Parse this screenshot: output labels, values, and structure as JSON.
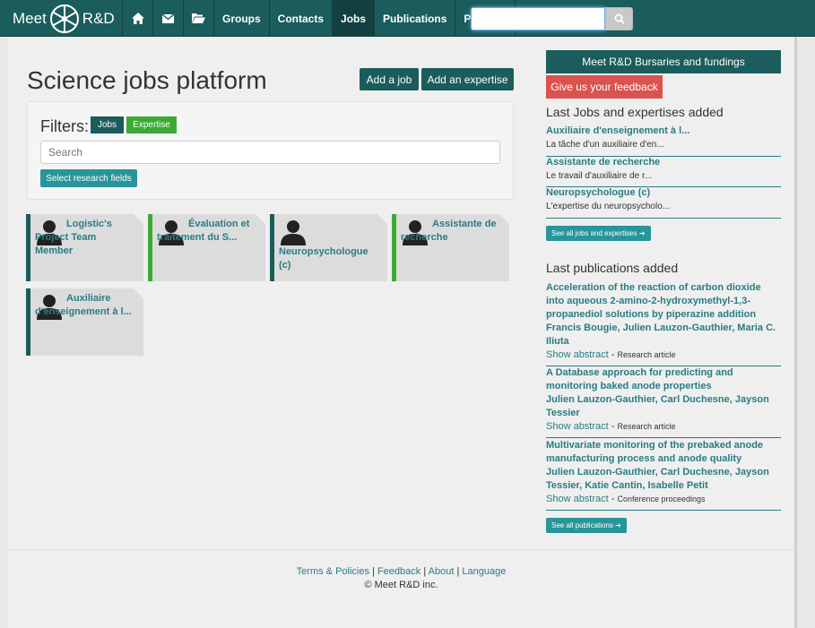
{
  "brand": {
    "left": "Meet",
    "right": "R&D"
  },
  "nav": {
    "home_icon": "home-icon",
    "mail_icon": "envelope-icon",
    "folder_icon": "folder-open-icon",
    "items": [
      {
        "label": "Groups"
      },
      {
        "label": "Contacts"
      },
      {
        "label": "Jobs",
        "active": true
      },
      {
        "label": "Publications"
      },
      {
        "label": "Projects"
      }
    ],
    "search_value": ""
  },
  "main": {
    "title": "Science jobs platform",
    "add_job": "Add a job",
    "add_expertise": "Add an expertise",
    "filters": {
      "label": "Filters:",
      "tag_jobs": "Jobs",
      "tag_expertise": "Expertise",
      "search_placeholder": "Search",
      "select_fields": "Select research fields"
    },
    "cards": [
      {
        "title": "Logistic's Project Team Member",
        "kind": "job"
      },
      {
        "title": "Évaluation et traitement du S...",
        "kind": "expertise"
      },
      {
        "title": "Neuropsychologue (c)",
        "kind": "job"
      },
      {
        "title": "Assistante de recherche",
        "kind": "expertise"
      },
      {
        "title": "Auxiliaire d'enseignement à l...",
        "kind": "job"
      }
    ]
  },
  "sidebar": {
    "bursaries": "Meet R&D Bursaries and fundings",
    "feedback": "Give us your feedback",
    "jobs_heading": "Last Jobs and expertises added",
    "jobs": [
      {
        "title": "Auxiliaire d'enseignement à l...",
        "snippet": "La tâche d'un auxiliaire d'en..."
      },
      {
        "title": "Assistante de recherche",
        "snippet": "Le travail d'auxiliaire de r..."
      },
      {
        "title": "Neuropsychologue (c)",
        "snippet": "L'expertise du neuropsycholo..."
      }
    ],
    "see_all_jobs": "See all jobs and expertises ➔",
    "pubs_heading": "Last publications added",
    "pubs": [
      {
        "title": "Acceleration of the reaction of carbon dioxide into aqueous 2-amino-2-hydroxymethyl-1,3-propanediol solutions by piperazine addition",
        "authors": "Francis Bougie, Julien Lauzon-Gauthier, Maria C. Iliuta",
        "show": "Show abstract",
        "type": "Research article"
      },
      {
        "title": "A Database approach for predicting and monitoring baked anode properties",
        "authors": "Julien Lauzon-Gauthier, Carl Duchesne, Jayson Tessier",
        "show": "Show abstract",
        "type": "Research article"
      },
      {
        "title": "Multivariate monitoring of the prebaked anode manufacturing process and anode quality",
        "authors": "Julien Lauzon-Gauthier, Carl Duchesne, Jayson Tessier, Katie Cantin, Isabelle Petit",
        "show": "Show abstract",
        "type": "Conference proceedings"
      }
    ],
    "see_all_pubs": "See all publications ➔"
  },
  "footer": {
    "terms": "Terms & Policies",
    "feedback": "Feedback",
    "about": "About",
    "language": "Language",
    "copyright": "© Meet R&D inc."
  },
  "colors": {
    "nav": "#1b5c5c",
    "job_bar": "#1b5c5c",
    "expertise_bar": "#3aaa35",
    "link": "#2a7c83",
    "feedback": "#d9534f"
  }
}
